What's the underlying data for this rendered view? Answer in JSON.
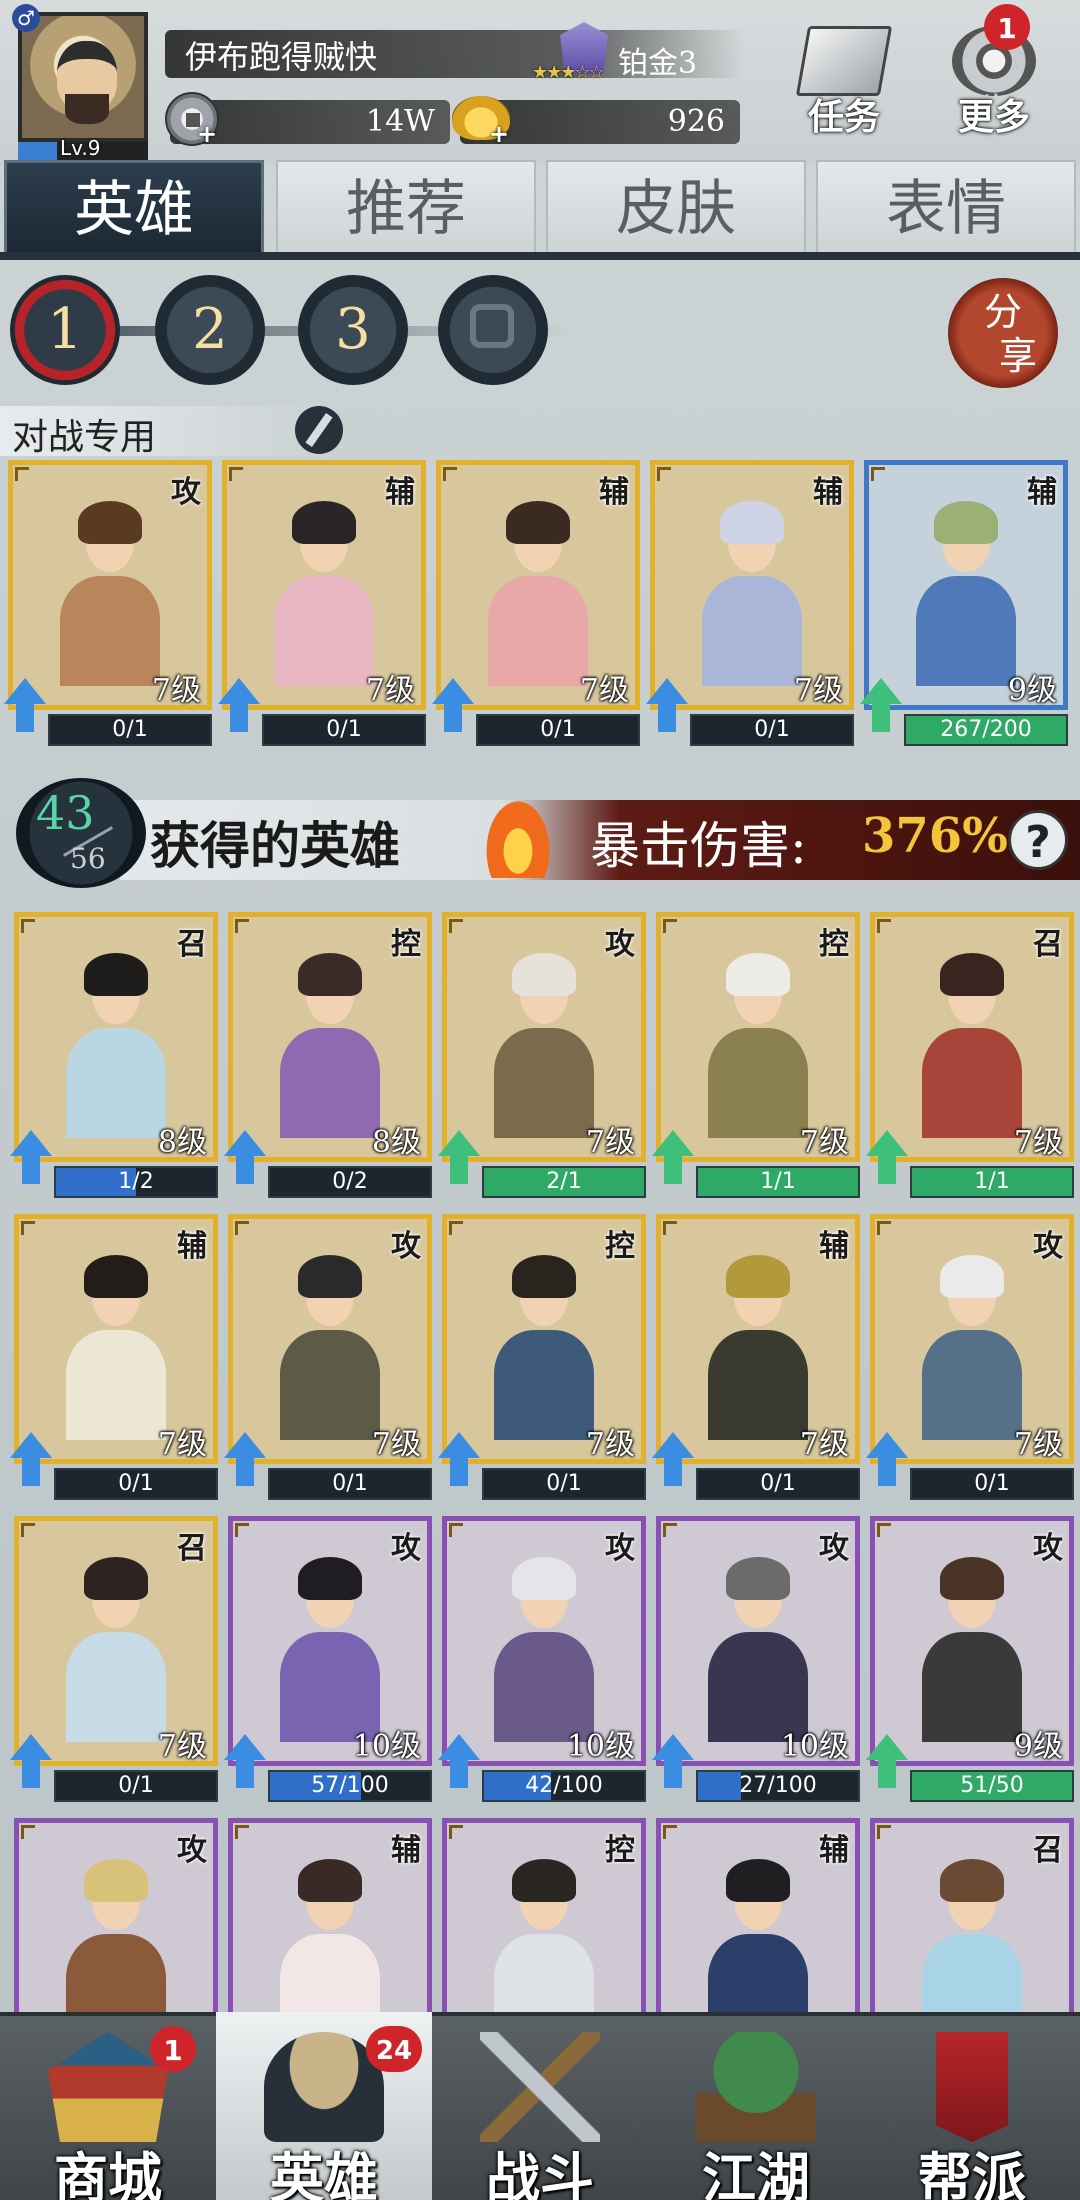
{
  "player": {
    "name": "伊布跑得贼快",
    "level_label": "Lv.9",
    "level_progress": 0.3,
    "rank": "铂金3",
    "rank_stars": "★★★☆☆",
    "gender_symbol": "♂"
  },
  "currency": {
    "silver": "14W",
    "gold": "926",
    "plus": "+"
  },
  "top_buttons": {
    "tasks": {
      "label": "任务"
    },
    "more": {
      "label": "更多",
      "badge": "1"
    }
  },
  "tabs": [
    {
      "label": "英雄",
      "active": true
    },
    {
      "label": "推荐",
      "active": false
    },
    {
      "label": "皮肤",
      "active": false
    },
    {
      "label": "表情",
      "active": false
    }
  ],
  "teams": [
    "1",
    "2",
    "3"
  ],
  "share": {
    "line1": "分",
    "line2": "享"
  },
  "team_label": "对战专用",
  "team_heroes": [
    {
      "role": "攻",
      "level": "7级",
      "progress": "0/1",
      "fill": 0,
      "frame": "gold",
      "up": "blue",
      "skin": "#b8865a",
      "hair": "#5a3a20"
    },
    {
      "role": "辅",
      "level": "7级",
      "progress": "0/1",
      "fill": 0,
      "frame": "gold",
      "up": "blue",
      "skin": "#e9b7c3",
      "hair": "#2a2628"
    },
    {
      "role": "辅",
      "level": "7级",
      "progress": "0/1",
      "fill": 0,
      "frame": "gold",
      "up": "blue",
      "skin": "#e8a8a8",
      "hair": "#3a2a22"
    },
    {
      "role": "辅",
      "level": "7级",
      "progress": "0/1",
      "fill": 0,
      "frame": "gold",
      "up": "blue",
      "skin": "#a9b6d8",
      "hair": "#cfd3e6"
    },
    {
      "role": "辅",
      "level": "9级",
      "progress": "267/200",
      "fill": 1,
      "frame": "blue",
      "up": "green",
      "skin": "#4f79b8",
      "hair": "#9ab074"
    }
  ],
  "collection": {
    "owned": "43",
    "total": "56",
    "title": "获得的英雄",
    "crit_label": "暴击伤害:",
    "crit_value": "376%",
    "help": "?"
  },
  "heroes": [
    {
      "role": "召",
      "level": "8级",
      "progress": "1/2",
      "fill": 0.5,
      "frame": "gold",
      "up": "blue",
      "skin": "#b9d6e2",
      "hair": "#1f1c1c"
    },
    {
      "role": "控",
      "level": "8级",
      "progress": "0/2",
      "fill": 0,
      "frame": "gold",
      "up": "blue",
      "skin": "#8e6bb0",
      "hair": "#3a2a28"
    },
    {
      "role": "攻",
      "level": "7级",
      "progress": "2/1",
      "fill": 1,
      "frame": "gold",
      "up": "green",
      "skin": "#7c6a4c",
      "hair": "#e6e2da"
    },
    {
      "role": "控",
      "level": "7级",
      "progress": "1/1",
      "fill": 1,
      "frame": "gold",
      "up": "green",
      "skin": "#8a8050",
      "hair": "#ecebe6"
    },
    {
      "role": "召",
      "level": "7级",
      "progress": "1/1",
      "fill": 1,
      "frame": "gold",
      "up": "green",
      "skin": "#a8453a",
      "hair": "#3a2420"
    },
    {
      "role": "辅",
      "level": "7级",
      "progress": "0/1",
      "fill": 0,
      "frame": "gold",
      "up": "blue",
      "skin": "#ece6d4",
      "hair": "#231d1a"
    },
    {
      "role": "攻",
      "level": "7级",
      "progress": "0/1",
      "fill": 0,
      "frame": "gold",
      "up": "blue",
      "skin": "#5e5a48",
      "hair": "#2a2a2a"
    },
    {
      "role": "控",
      "level": "7级",
      "progress": "0/1",
      "fill": 0,
      "frame": "gold",
      "up": "blue",
      "skin": "#3d5a7a",
      "hair": "#2a241f"
    },
    {
      "role": "辅",
      "level": "7级",
      "progress": "0/1",
      "fill": 0,
      "frame": "gold",
      "up": "blue",
      "skin": "#3b3a30",
      "hair": "#b29a3a"
    },
    {
      "role": "攻",
      "level": "7级",
      "progress": "0/1",
      "fill": 0,
      "frame": "gold",
      "up": "blue",
      "skin": "#56708a",
      "hair": "#eaeaea"
    },
    {
      "role": "召",
      "level": "7级",
      "progress": "0/1",
      "fill": 0,
      "frame": "gold",
      "up": "blue",
      "skin": "#c7dbe6",
      "hair": "#2b2420"
    },
    {
      "role": "攻",
      "level": "10级",
      "progress": "57/100",
      "fill": 0.57,
      "frame": "purple",
      "up": "blue",
      "skin": "#7a63b0",
      "hair": "#1f1c22"
    },
    {
      "role": "攻",
      "level": "10级",
      "progress": "42/100",
      "fill": 0.42,
      "frame": "purple",
      "up": "blue",
      "skin": "#6a5a8a",
      "hair": "#e4e4ea"
    },
    {
      "role": "攻",
      "level": "10级",
      "progress": "27/100",
      "fill": 0.27,
      "frame": "purple",
      "up": "blue",
      "skin": "#3a3550",
      "hair": "#6b6b6b"
    },
    {
      "role": "攻",
      "level": "9级",
      "progress": "51/50",
      "fill": 1,
      "frame": "purple",
      "up": "green",
      "skin": "#3a3a3a",
      "hair": "#4a3426"
    },
    {
      "role": "攻",
      "level": "",
      "progress": "",
      "fill": 0,
      "frame": "purple",
      "up": "none",
      "skin": "#8a5a3a",
      "hair": "#d8c27a"
    },
    {
      "role": "辅",
      "level": "",
      "progress": "",
      "fill": 0,
      "frame": "purple",
      "up": "none",
      "skin": "#f2e6e6",
      "hair": "#3a2a26"
    },
    {
      "role": "控",
      "level": "",
      "progress": "",
      "fill": 0,
      "frame": "purple",
      "up": "none",
      "skin": "#dfe3e8",
      "hair": "#2a2622"
    },
    {
      "role": "辅",
      "level": "",
      "progress": "",
      "fill": 0,
      "frame": "purple",
      "up": "none",
      "skin": "#2c3f6a",
      "hair": "#1f1f22"
    },
    {
      "role": "召",
      "level": "",
      "progress": "",
      "fill": 0,
      "frame": "purple",
      "up": "none",
      "skin": "#a9d3e6",
      "hair": "#6a4a32"
    }
  ],
  "bottom_nav": [
    {
      "label": "商城",
      "icon": "shop-icon",
      "badge": "1",
      "active": false
    },
    {
      "label": "英雄",
      "icon": "hero-icon",
      "badge": "24",
      "active": true
    },
    {
      "label": "战斗",
      "icon": "battle-icon",
      "badge": "",
      "active": false
    },
    {
      "label": "江湖",
      "icon": "world-icon",
      "badge": "",
      "active": false
    },
    {
      "label": "帮派",
      "icon": "guild-icon",
      "badge": "",
      "active": false
    }
  ]
}
